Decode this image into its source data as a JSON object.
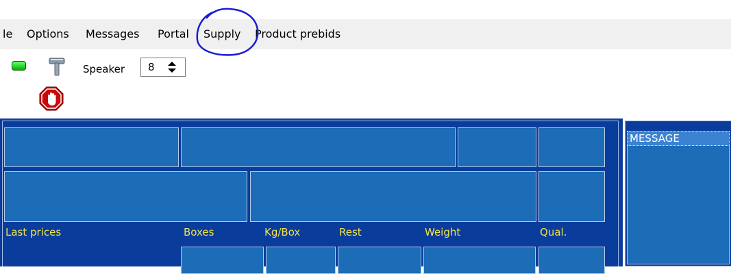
{
  "menu": {
    "items": [
      "le",
      "Options",
      "Messages",
      "Portal",
      "Supply",
      "Product prebids"
    ]
  },
  "toolbar": {
    "speaker_label": "Speaker",
    "speaker_value": "8"
  },
  "table": {
    "headers": [
      "Last prices",
      "Boxes",
      "Kg/Box",
      "Rest",
      "Weight",
      "Qual."
    ]
  },
  "message_panel": {
    "header": "MESSAGE"
  },
  "colors": {
    "panel_bg": "#0a3c9c",
    "cell_bg": "#1c6cb7",
    "label_text": "#f2e34a",
    "annotation": "#1b1bd6"
  },
  "icons": [
    "green-status-icon",
    "hammer-icon",
    "stop-hand-icon",
    "spin-arrows-icon"
  ]
}
